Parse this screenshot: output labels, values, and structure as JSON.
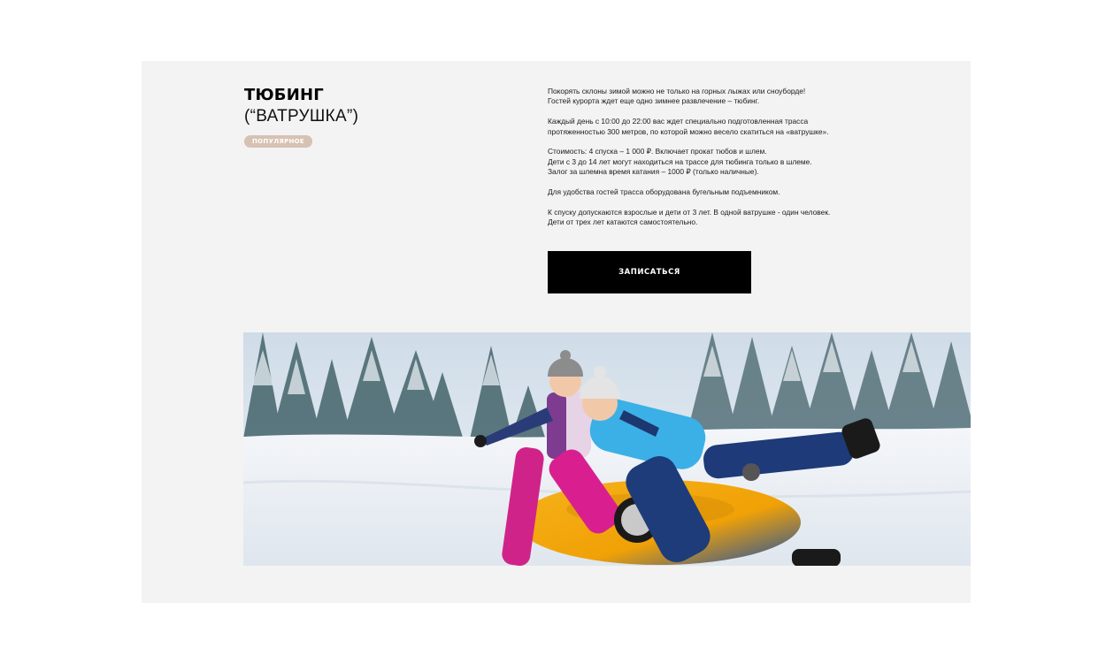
{
  "section": {
    "title": "ТЮБИНГ",
    "subtitle": "(“ВАТРУШКА”)",
    "badge": "ПОПУЛЯРНОЕ"
  },
  "description": {
    "paragraphs": [
      [
        "Покорять склоны зимой можно не только на горных лыжах или сноуборде!",
        "Гостей курорта  ждет еще одно зимнее развлечение – тюбинг."
      ],
      [
        "Каждый день с 10:00 до 22:00 вас ждет специально подготовленная трасса",
        "протяженностью 300 метров, по которой можно весело скатиться на «ватрушке»."
      ],
      [
        "Стоимость: 4 спуска – 1 000 ₽. Включает прокат тюбов и шлем.",
        "Дети с 3 до 14 лет могут находиться на трассе для тюбинга только в шлеме.",
        "Залог за шлемна время катания – 1000 ₽ (только наличные)."
      ],
      [
        "Для удобства гостей трасса оборудована бугельным подъемником."
      ],
      [
        "К спуску допускаются взрослые и дети от 3 лет. В одной ватрушке - один человек.",
        "Дети от трех лет катаются самостоятельно."
      ]
    ]
  },
  "cta": {
    "label": "ЗАПИСАТЬСЯ"
  },
  "photo": {
    "icon": "photo-kids-snow-tubing"
  },
  "colors": {
    "card_bg": "#f3f3f3",
    "badge_bg": "#d7c1b2",
    "button_bg": "#000000"
  }
}
